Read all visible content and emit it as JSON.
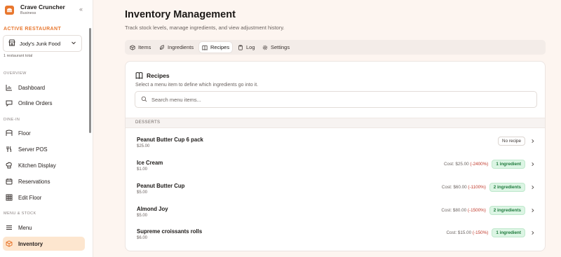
{
  "brand": {
    "name": "Crave Cruncher",
    "sub": "Business"
  },
  "sidebar": {
    "active_label": "ACTIVE RESTAURANT",
    "restaurant": "Jody's Junk Food",
    "restaurant_count": "1 restaurant total",
    "sections": {
      "overview": "OVERVIEW",
      "dine_in": "DINE-IN",
      "menu_stock": "MENU & STOCK"
    },
    "items": [
      {
        "label": "Dashboard",
        "icon": "chart-icon"
      },
      {
        "label": "Online Orders",
        "icon": "chat-icon"
      },
      {
        "label": "Floor",
        "icon": "floor-icon"
      },
      {
        "label": "Server POS",
        "icon": "utensils-icon"
      },
      {
        "label": "Kitchen Display",
        "icon": "chef-hat-icon"
      },
      {
        "label": "Reservations",
        "icon": "calendar-icon"
      },
      {
        "label": "Edit Floor",
        "icon": "grid-icon"
      },
      {
        "label": "Menu",
        "icon": "menu-icon"
      },
      {
        "label": "Inventory",
        "icon": "box-icon"
      }
    ]
  },
  "page": {
    "title": "Inventory Management",
    "subtitle": "Track stock levels, manage ingredients, and view adjustment history."
  },
  "tabs": [
    {
      "label": "Items",
      "icon": "box-icon"
    },
    {
      "label": "Ingredients",
      "icon": "leaf-icon"
    },
    {
      "label": "Recipes",
      "icon": "book-icon",
      "active": true
    },
    {
      "label": "Log",
      "icon": "clipboard-icon"
    },
    {
      "label": "Settings",
      "icon": "gear-icon"
    }
  ],
  "recipes": {
    "title": "Recipes",
    "description": "Select a menu item to define which ingredients go into it.",
    "search_placeholder": "Search menu items...",
    "category": "DESSERTS",
    "rows": [
      {
        "name": "Peanut Butter Cup 6 pack",
        "price": "$25.00",
        "cost": "",
        "pct": "",
        "badge": "No recipe",
        "badge_type": "none"
      },
      {
        "name": "Ice Cream",
        "price": "$1.00",
        "cost": "Cost: $25.00",
        "pct": "(-2400%)",
        "badge": "1 ingredient",
        "badge_type": "ing"
      },
      {
        "name": "Peanut Butter Cup",
        "price": "$5.00",
        "cost": "Cost: $60.00",
        "pct": "(-1100%)",
        "badge": "2 ingredients",
        "badge_type": "ing"
      },
      {
        "name": "Almond Joy",
        "price": "$5.00",
        "cost": "Cost: $80.00",
        "pct": "(-1500%)",
        "badge": "2 ingredients",
        "badge_type": "ing"
      },
      {
        "name": "Supreme croissants rolls",
        "price": "$6.00",
        "cost": "Cost: $15.00",
        "pct": "(-150%)",
        "badge": "1 ingredient",
        "badge_type": "ing"
      }
    ]
  },
  "colors": {
    "accent": "#e8772e",
    "active_bg": "#fde6cf",
    "success": "#1e7a3c",
    "danger": "#c0392b"
  }
}
